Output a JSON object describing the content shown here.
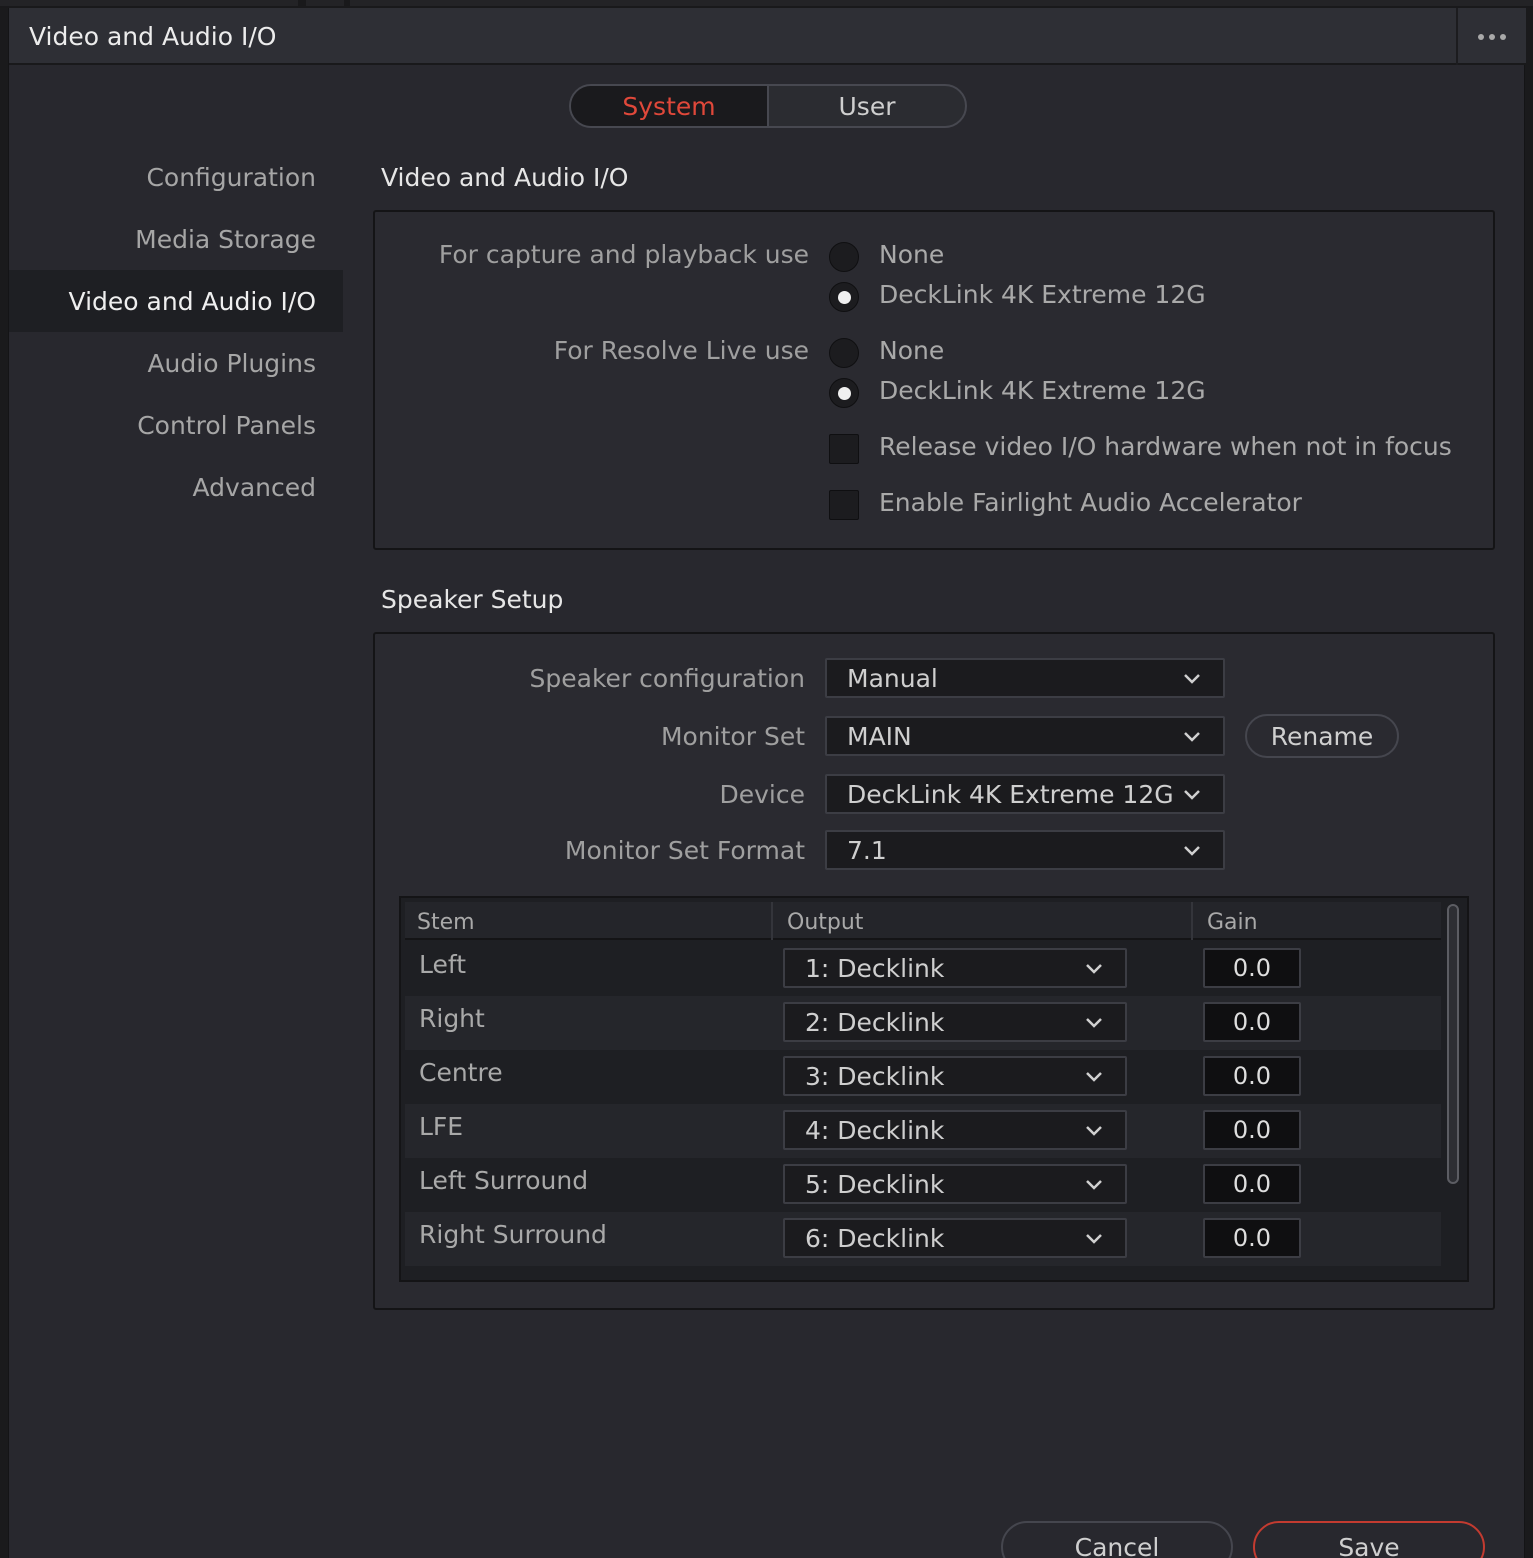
{
  "window": {
    "title": "Video and Audio I/O"
  },
  "tabs": {
    "system": "System",
    "user": "User"
  },
  "sidebar": {
    "items": [
      {
        "label": "Configuration",
        "active": false
      },
      {
        "label": "Media Storage",
        "active": false
      },
      {
        "label": "Video and Audio I/O",
        "active": true
      },
      {
        "label": "Audio Plugins",
        "active": false
      },
      {
        "label": "Control Panels",
        "active": false
      },
      {
        "label": "Advanced",
        "active": false
      }
    ]
  },
  "video_io": {
    "title": "Video and Audio I/O",
    "capture_label": "For capture and playback use",
    "capture_options": [
      "None",
      "DeckLink 4K Extreme 12G"
    ],
    "capture_selected": "DeckLink 4K Extreme 12G",
    "live_label": "For Resolve Live use",
    "live_options": [
      "None",
      "DeckLink 4K Extreme 12G"
    ],
    "live_selected": "DeckLink 4K Extreme 12G",
    "release_label": "Release video I/O hardware when not in focus",
    "release_checked": false,
    "fairlight_label": "Enable Fairlight Audio Accelerator",
    "fairlight_checked": false
  },
  "speaker": {
    "title": "Speaker Setup",
    "config_label": "Speaker configuration",
    "config_value": "Manual",
    "monitor_set_label": "Monitor Set",
    "monitor_set_value": "MAIN",
    "rename_label": "Rename",
    "device_label": "Device",
    "device_value": "DeckLink 4K Extreme 12G",
    "format_label": "Monitor Set Format",
    "format_value": "7.1",
    "table": {
      "headers": {
        "stem": "Stem",
        "output": "Output",
        "gain": "Gain"
      },
      "rows": [
        {
          "stem": "Left",
          "output": "1: Decklink",
          "gain": "0.0"
        },
        {
          "stem": "Right",
          "output": "2: Decklink",
          "gain": "0.0"
        },
        {
          "stem": "Centre",
          "output": "3: Decklink",
          "gain": "0.0"
        },
        {
          "stem": "LFE",
          "output": "4: Decklink",
          "gain": "0.0"
        },
        {
          "stem": "Left Surround",
          "output": "5: Decklink",
          "gain": "0.0"
        },
        {
          "stem": "Right Surround",
          "output": "6: Decklink",
          "gain": "0.0"
        }
      ]
    }
  },
  "footer": {
    "cancel": "Cancel",
    "save": "Save"
  },
  "colors": {
    "accent": "#e0483a",
    "save_border": "#c33b30",
    "background": "#28282e"
  },
  "icons": {
    "menu": "more-horizontal-icon",
    "dropdown": "chevron-down-icon"
  }
}
